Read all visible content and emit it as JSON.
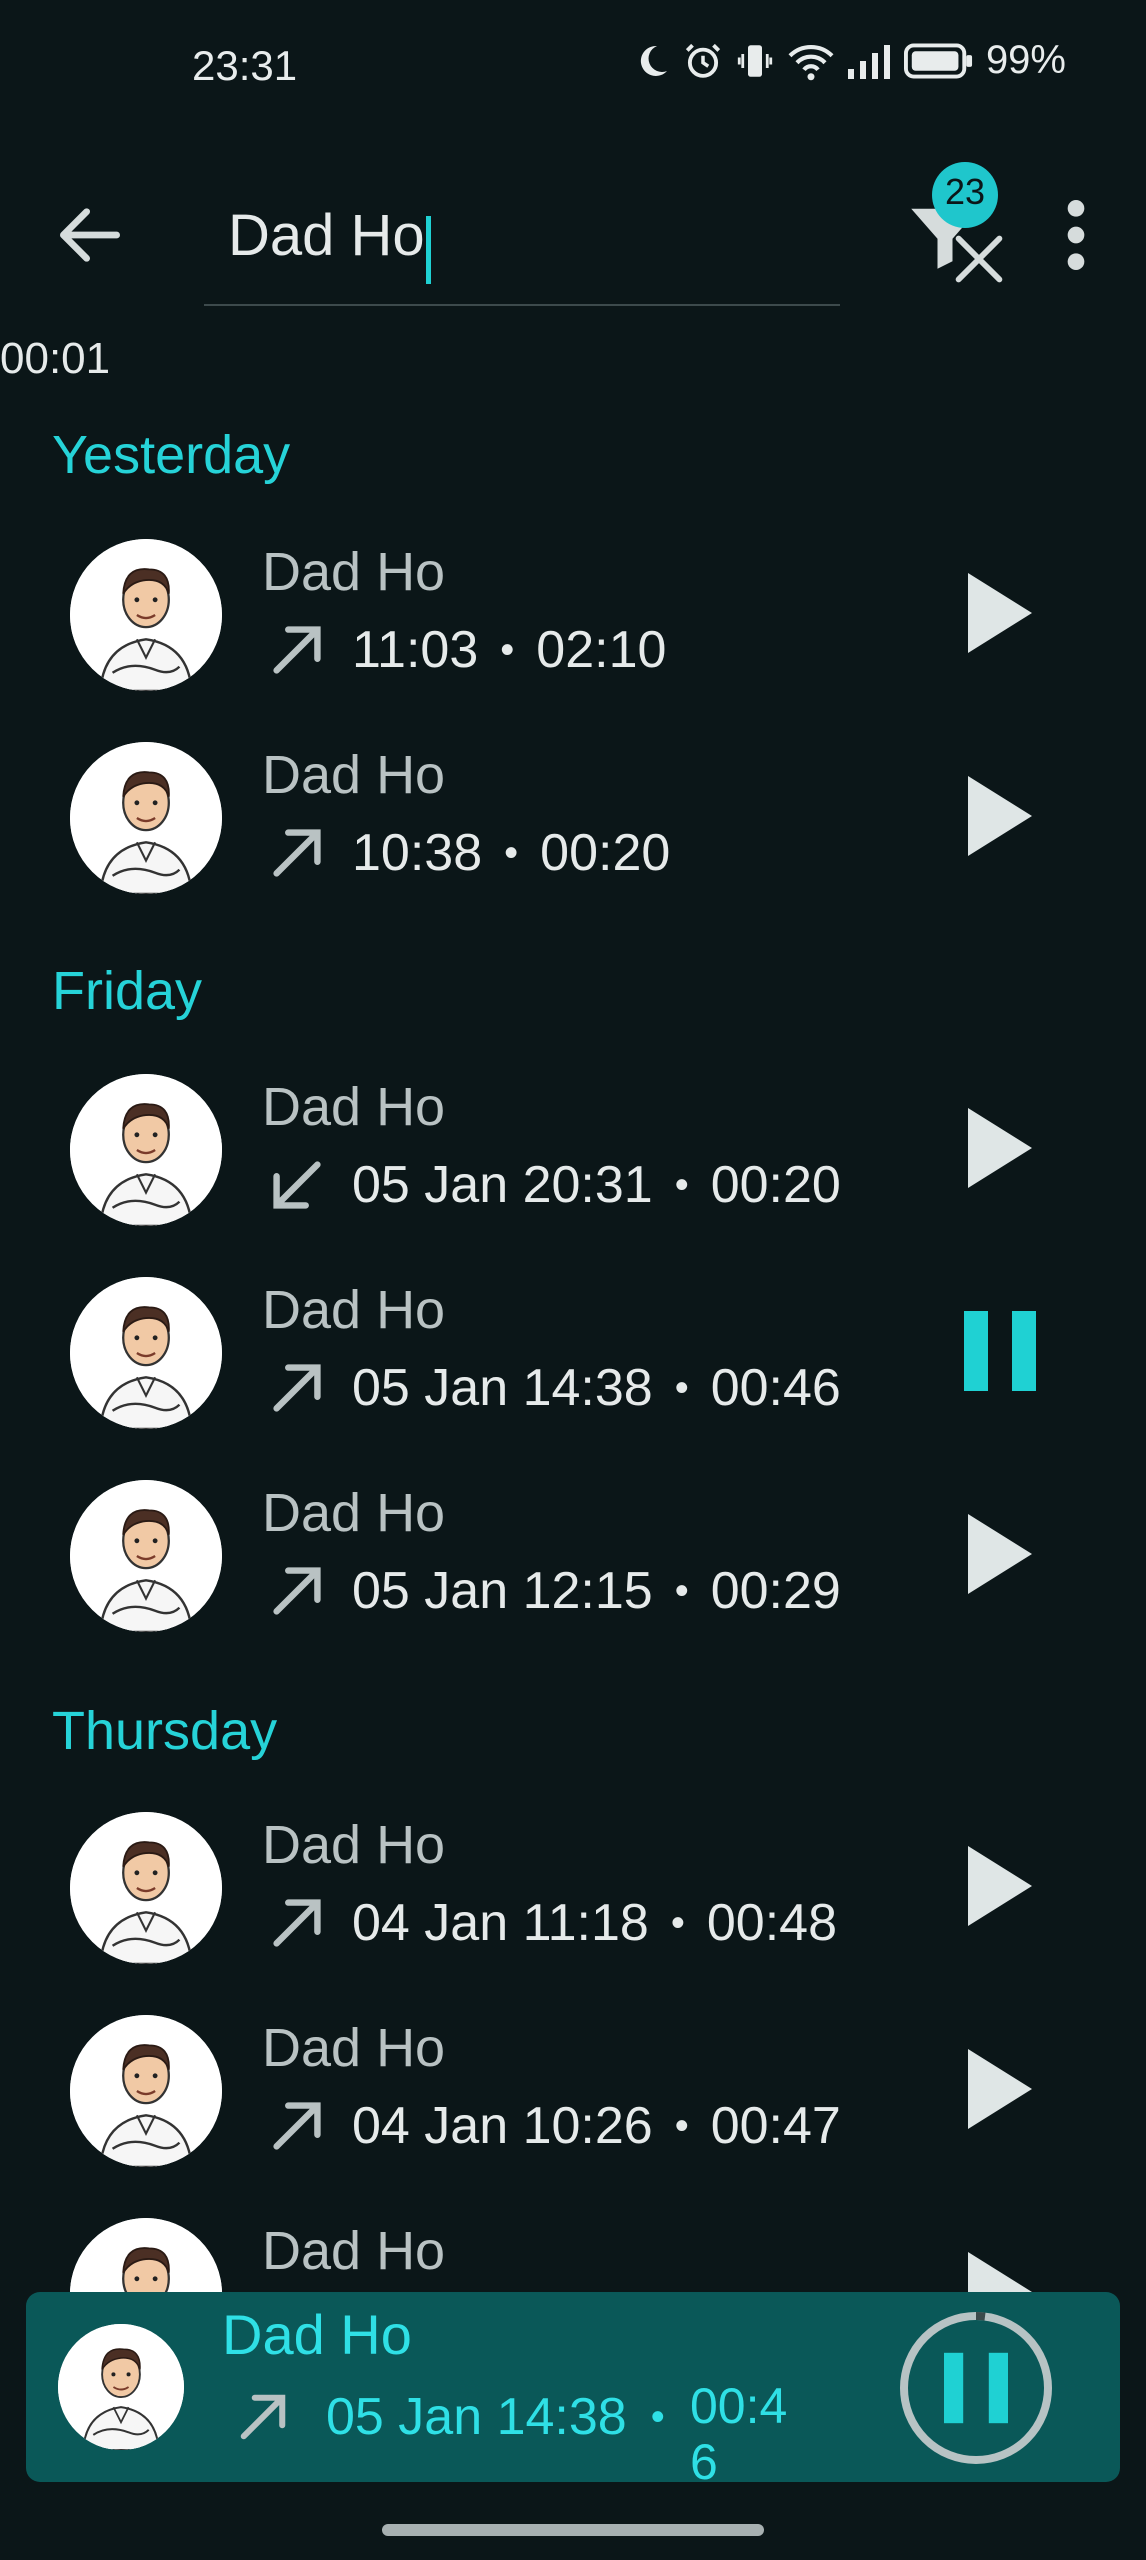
{
  "status_bar": {
    "time": "23:31",
    "battery": "99%"
  },
  "search": {
    "query": "Dad Ho",
    "filter_count": "23"
  },
  "elapsed": "00:01",
  "sections": [
    {
      "title": "Yesterday",
      "calls": [
        {
          "name": "Dad Ho",
          "direction": "outgoing",
          "time": "11:03",
          "duration": "02:10",
          "state": "play"
        },
        {
          "name": "Dad Ho",
          "direction": "outgoing",
          "time": "10:38",
          "duration": "00:20",
          "state": "play"
        }
      ]
    },
    {
      "title": "Friday",
      "calls": [
        {
          "name": "Dad Ho",
          "direction": "incoming",
          "time": "05 Jan 20:31",
          "duration": "00:20",
          "state": "play"
        },
        {
          "name": "Dad Ho",
          "direction": "outgoing",
          "time": "05 Jan 14:38",
          "duration": "00:46",
          "state": "pause"
        },
        {
          "name": "Dad Ho",
          "direction": "outgoing",
          "time": "05 Jan 12:15",
          "duration": "00:29",
          "state": "play"
        }
      ]
    },
    {
      "title": "Thursday",
      "calls": [
        {
          "name": "Dad Ho",
          "direction": "outgoing",
          "time": "04 Jan 11:18",
          "duration": "00:48",
          "state": "play"
        },
        {
          "name": "Dad Ho",
          "direction": "outgoing",
          "time": "04 Jan 10:26",
          "duration": "00:47",
          "state": "play"
        },
        {
          "name": "Dad Ho",
          "direction": "outgoing",
          "time": "",
          "duration": "",
          "state": "play"
        }
      ]
    }
  ],
  "mini_player": {
    "name": "Dad Ho",
    "time": "05 Jan 14:38",
    "duration": "00:46",
    "progress": 0.02
  },
  "colors": {
    "accent": "#26d3d8",
    "background": "#0b1618",
    "player_background": "#0a5858"
  }
}
